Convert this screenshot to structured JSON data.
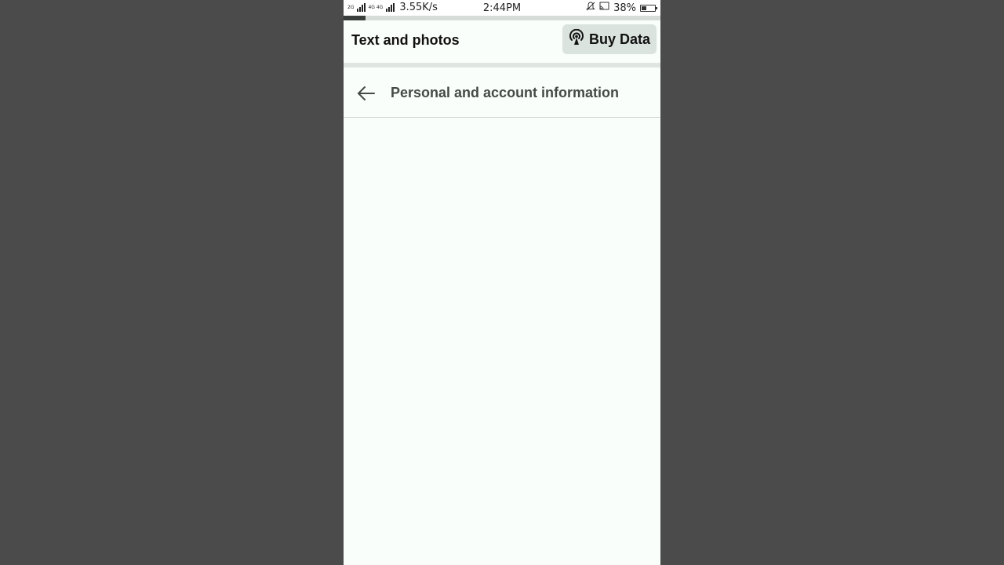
{
  "status_bar": {
    "network_label_1": "2G",
    "network_label_2": "4G 4G",
    "speed": "3.55K/s",
    "time": "2:44PM",
    "battery": "38%",
    "battery_level": 0.38,
    "icons": [
      "signal-icon",
      "signal-icon",
      "mute-icon",
      "cast-icon",
      "battery-icon"
    ]
  },
  "progress": {
    "fraction": 0.07,
    "color": "#3a3e3c"
  },
  "header": {
    "title": "Text and photos",
    "buy_data_label": "Buy Data",
    "buy_data_icon": "hotspot-icon"
  },
  "page": {
    "back_icon": "back-arrow-icon",
    "title": "Personal and account information"
  },
  "colors": {
    "background": "#4b4b4b",
    "screen": "#f9fefa",
    "button_bg": "#dbe3df"
  }
}
